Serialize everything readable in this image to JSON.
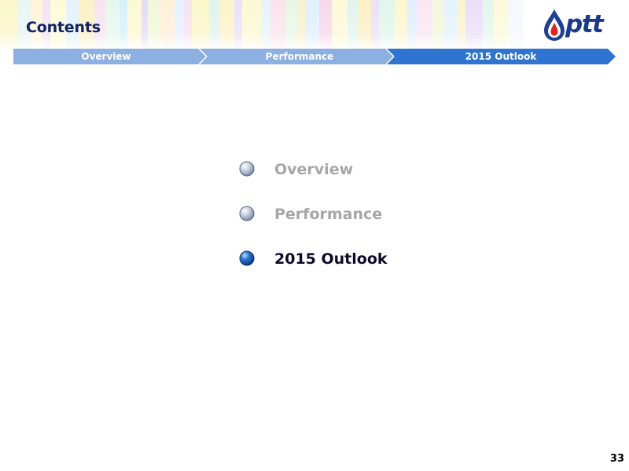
{
  "header": {
    "title": "Contents",
    "logo_text": "ptt"
  },
  "nav": {
    "steps": [
      {
        "label": "Overview",
        "state": "inactive"
      },
      {
        "label": "Performance",
        "state": "inactive"
      },
      {
        "label": "2015 Outlook",
        "state": "active"
      }
    ]
  },
  "agenda": {
    "items": [
      {
        "label": "Overview",
        "state": "inactive"
      },
      {
        "label": "Performance",
        "state": "inactive"
      },
      {
        "label": "2015 Outlook",
        "state": "active"
      }
    ]
  },
  "footer": {
    "page_number": "33"
  },
  "colors": {
    "title": "#10226b",
    "nav_inactive": "#8db0e2",
    "nav_active": "#2e74d0",
    "text_inactive": "#a6a6a6",
    "text_active": "#0a0a2a"
  }
}
